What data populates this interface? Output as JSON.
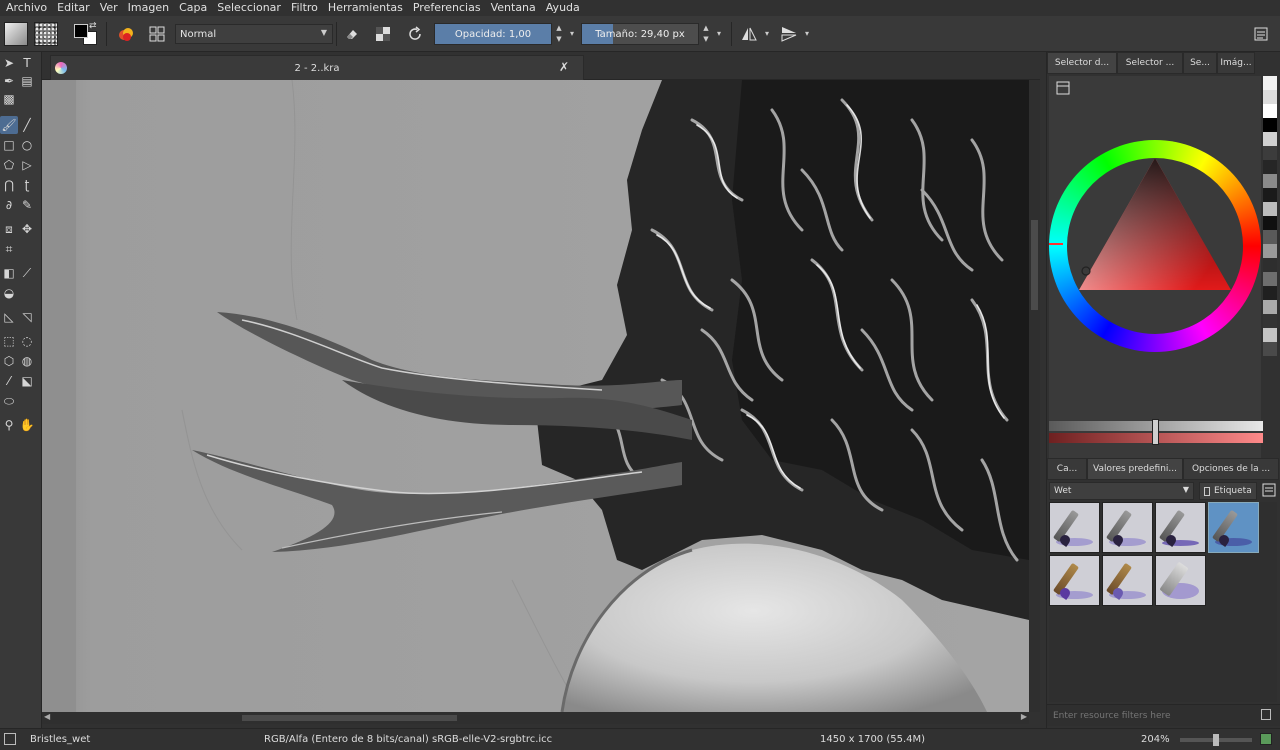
{
  "menu": [
    "Archivo",
    "Editar",
    "Ver",
    "Imagen",
    "Capa",
    "Seleccionar",
    "Filtro",
    "Herramientas",
    "Preferencias",
    "Ventana",
    "Ayuda"
  ],
  "toolbar": {
    "blend_mode": "Normal",
    "opacity_label": "Opacidad:",
    "opacity_value": "1,00",
    "opacity_fraction": 1.0,
    "size_label": "Tamaño:",
    "size_value": "29,40 px",
    "size_fraction": 0.27
  },
  "document": {
    "tab_title": "2 - 2..kra"
  },
  "dock": {
    "top_tabs": [
      "Selector d...",
      "Selector ...",
      "Se...",
      "Imág..."
    ],
    "bottom_tabs": [
      "Ca...",
      "Valores predefini...",
      "Opciones de la ..."
    ],
    "preset_filter": "Wet",
    "tag_label": "Etiqueta",
    "resource_filter_placeholder": "Enter resource filters here",
    "palette_colors": [
      "#f2f2f2",
      "#dcdcdc",
      "#ffffff",
      "#000000",
      "#d0d0d0",
      "#3c3c3c",
      "#262626",
      "#8a8a8a",
      "#1a1a1a",
      "#bcbcbc",
      "#101010",
      "#5a5a5a",
      "#9a9a9a",
      "#2e2e2e",
      "#6e6e6e",
      "#202020",
      "#aaaaaa",
      "#343434",
      "#c4c4c4",
      "#4a4a4a"
    ],
    "hue_accent": "#e63030"
  },
  "status": {
    "brush_name": "Bristles_wet",
    "color_space": "RGB/Alfa (Entero de 8 bits/canal)  sRGB-elle-V2-srgbtrc.icc",
    "image_size": "1450 x 1700 (55.4M)",
    "zoom": "204%",
    "zoom_fraction": 0.5
  }
}
